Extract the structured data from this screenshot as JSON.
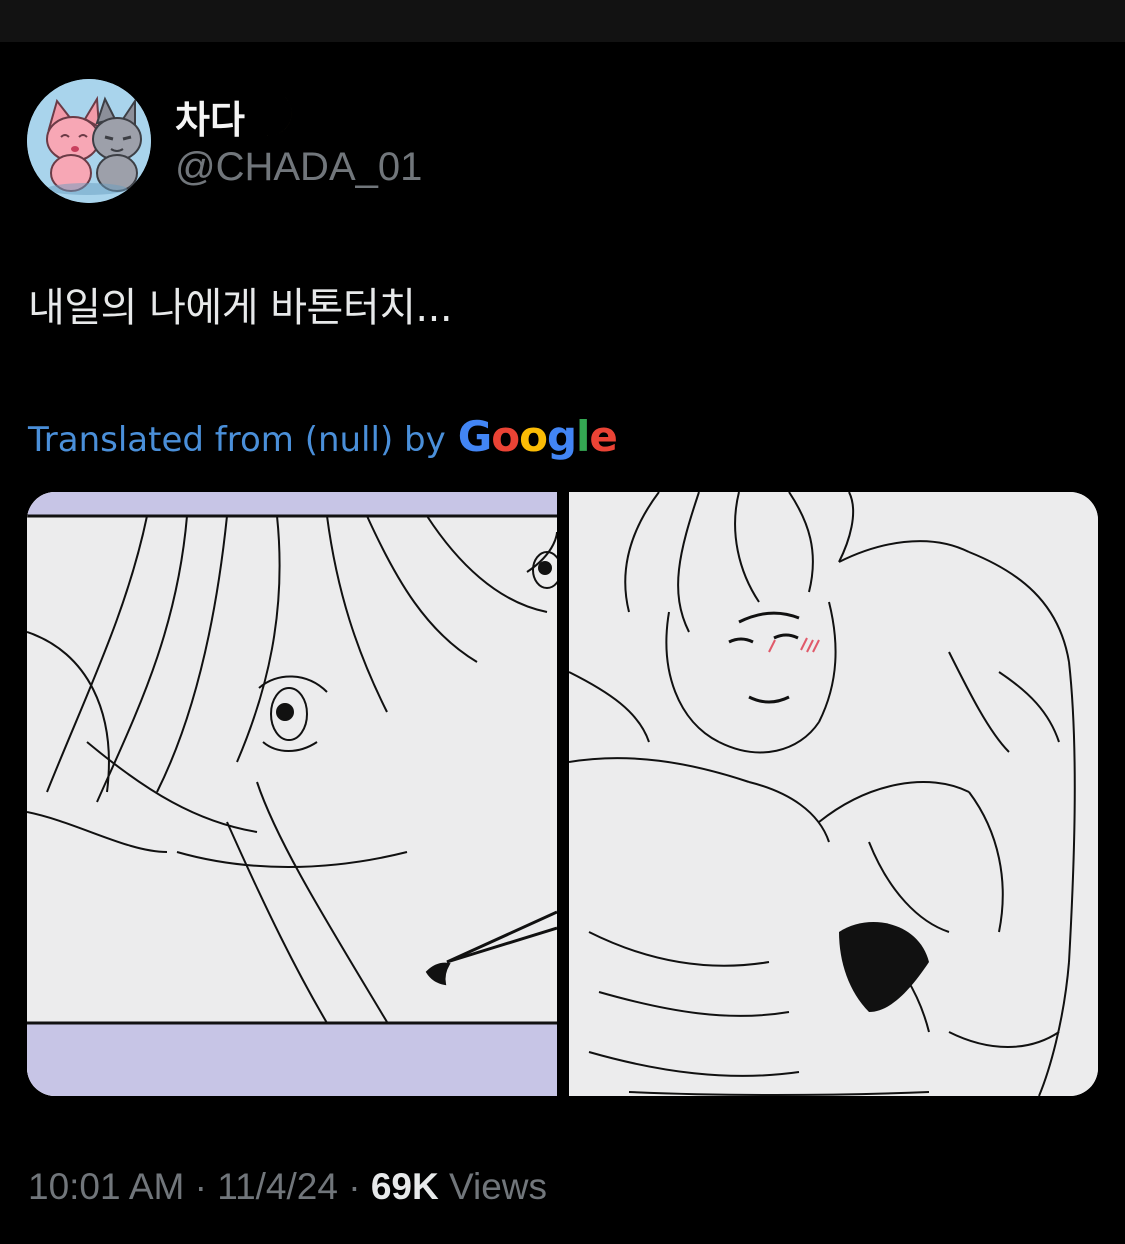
{
  "author": {
    "display_name": "차다",
    "handle": "@CHADA_01"
  },
  "tweet": {
    "text": "내일의 나에게 바톤터치...",
    "translated_prefix": "Translated from (null) by",
    "translated_brand": "Google",
    "media_count": 2
  },
  "meta": {
    "time": "10:01 AM",
    "separator": " · ",
    "date": "11/4/24",
    "views_count": "69K",
    "views_label": "Views"
  },
  "colors": {
    "background": "#000000",
    "text_primary": "#e7e9ea",
    "text_secondary": "#71767b",
    "link": "#4a8fd9",
    "google_blue": "#4285F4",
    "google_red": "#EA4335",
    "google_yellow": "#FBBC05",
    "google_green": "#34A853",
    "panel_lavender": "#c7c5e6"
  }
}
